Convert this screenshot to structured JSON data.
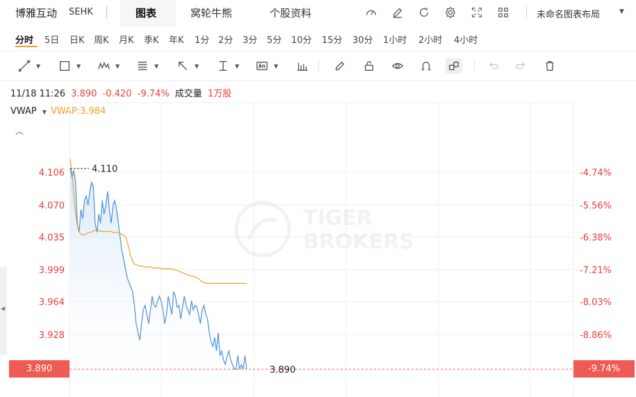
{
  "header": {
    "stock_name": "博雅互动",
    "exchange": "SEHK",
    "tabs": [
      {
        "label": "图表",
        "active": true
      },
      {
        "label": "窝轮牛熊",
        "active": false
      },
      {
        "label": "个股资料",
        "active": false
      }
    ],
    "icons": [
      "gauge-icon",
      "edit-icon",
      "refresh-icon",
      "settings-icon",
      "fullscreen-icon",
      "grid-icon"
    ],
    "layout_name": "未命名图表布局"
  },
  "periods": [
    {
      "label": "分时",
      "active": true
    },
    {
      "label": "5日"
    },
    {
      "label": "日K"
    },
    {
      "label": "周K"
    },
    {
      "label": "月K"
    },
    {
      "label": "季K"
    },
    {
      "label": "年K"
    },
    {
      "label": "1分"
    },
    {
      "label": "2分"
    },
    {
      "label": "3分"
    },
    {
      "label": "5分"
    },
    {
      "label": "10分"
    },
    {
      "label": "15分"
    },
    {
      "label": "30分"
    },
    {
      "label": "1小时"
    },
    {
      "label": "2小时"
    },
    {
      "label": "4小时"
    }
  ],
  "info": {
    "datetime": "11/18 11:26",
    "price": "3.890",
    "change": "-0.420",
    "change_pct": "-9.74%",
    "volume_label": "成交量",
    "volume": "1万股"
  },
  "indicator": {
    "name": "VWAP",
    "value_text": "VWAP:3.984"
  },
  "watermark": {
    "line1": "TIGER",
    "line2": "BROKERS"
  },
  "colors": {
    "price_line": "#4a90d9",
    "vwap_line": "#f0a020",
    "down": "#e5403a"
  },
  "chart_data": {
    "type": "line",
    "title": "",
    "xlabel": "",
    "ylabel": "",
    "ylim": [
      3.876,
      4.13
    ],
    "y_ticks_left": [
      "4.106",
      "4.070",
      "4.035",
      "3.999",
      "3.964",
      "3.928"
    ],
    "y_ticks_right": [
      "-4.74%",
      "-5.56%",
      "-6.38%",
      "-7.21%",
      "-8.03%",
      "-8.86%"
    ],
    "last_price_label": "3.890",
    "last_pct_label": "-9.74%",
    "high_label": "4.110",
    "high_value": 4.11,
    "last_value": 3.89,
    "series": [
      {
        "name": "",
        "role": "price",
        "values": [
          4.11,
          4.1,
          4.108,
          4.095,
          4.05,
          4.04,
          4.065,
          4.055,
          4.075,
          4.08,
          4.07,
          4.085,
          4.095,
          4.09,
          4.05,
          4.04,
          4.06,
          4.05,
          4.075,
          4.06,
          4.07,
          4.085,
          4.065,
          4.05,
          4.07,
          4.075,
          4.065,
          4.05,
          4.035,
          4.02,
          4.01,
          4.0,
          3.99,
          3.985,
          3.98,
          3.975,
          3.96,
          3.94,
          3.93,
          3.922,
          3.94,
          3.955,
          3.96,
          3.95,
          3.94,
          3.955,
          3.97,
          3.96,
          3.958,
          3.965,
          3.97,
          3.965,
          3.955,
          3.94,
          3.95,
          3.97,
          3.96,
          3.95,
          3.975,
          3.97,
          3.958,
          3.96,
          3.945,
          3.958,
          3.97,
          3.96,
          3.955,
          3.95,
          3.965,
          3.955,
          3.96,
          3.958,
          3.95,
          3.94,
          3.955,
          3.96,
          3.95,
          3.945,
          3.93,
          3.92,
          3.915,
          3.925,
          3.91,
          3.93,
          3.905,
          3.91,
          3.9,
          3.895,
          3.905,
          3.91,
          3.9,
          3.895,
          3.89,
          3.89,
          3.905,
          3.89,
          3.895,
          3.89,
          3.905,
          3.89
        ]
      },
      {
        "name": "VWAP",
        "role": "vwap",
        "values": [
          4.12,
          4.1,
          4.07,
          4.05,
          4.04,
          4.038,
          4.037,
          4.038,
          4.04,
          4.04,
          4.041,
          4.042,
          4.042,
          4.042,
          4.041,
          4.041,
          4.041,
          4.041,
          4.041,
          4.04,
          4.04,
          4.04,
          4.039,
          4.038,
          4.037,
          4.034,
          4.025,
          4.015,
          4.008,
          4.005,
          4.004,
          4.003,
          4.003,
          4.002,
          4.002,
          4.002,
          4.002,
          4.001,
          4.001,
          4.001,
          4.001,
          4.0,
          4.0,
          4.0,
          4.0,
          4.0,
          3.999,
          3.999,
          3.998,
          3.997,
          3.996,
          3.995,
          3.994,
          3.993,
          3.992,
          3.992,
          3.991,
          3.99,
          3.988,
          3.986,
          3.985,
          3.984,
          3.984,
          3.984,
          3.984,
          3.984,
          3.984,
          3.984,
          3.984,
          3.984,
          3.984,
          3.984,
          3.984,
          3.984,
          3.984,
          3.984,
          3.984,
          3.984,
          3.984,
          3.984
        ]
      }
    ],
    "grid": true
  }
}
